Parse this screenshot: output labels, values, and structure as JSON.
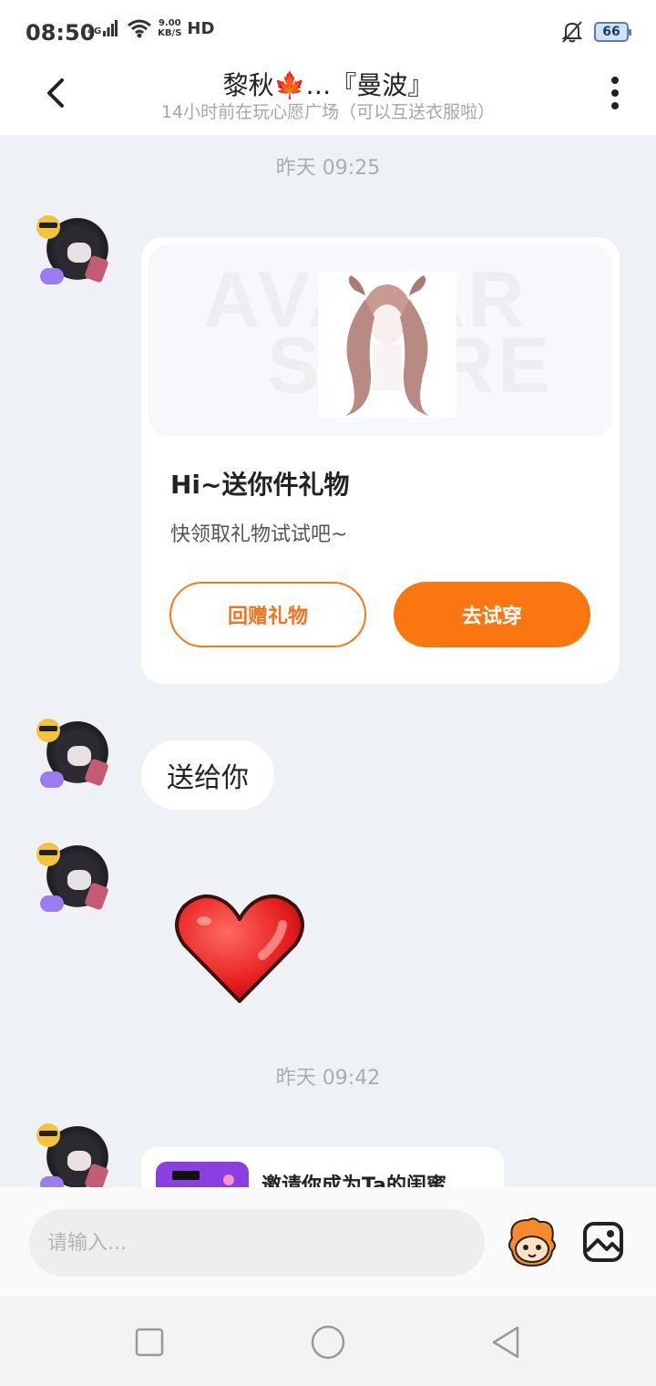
{
  "status_bar": {
    "time": "08:50",
    "network": "4G",
    "speed_value": "9.00",
    "speed_unit": "KB/S",
    "hd": "HD",
    "battery": "66"
  },
  "header": {
    "title": "黎秋🍁…『曼波』",
    "subtitle": "14小时前在玩心愿广场（可以互送衣服啦）"
  },
  "chat": {
    "timestamp_1": "昨天 09:25",
    "gift_card": {
      "watermark_line1": "AVATAR",
      "watermark_line2": "STORE",
      "title": "Hi~送你件礼物",
      "description": "快领取礼物试试吧~",
      "return_gift_label": "回赠礼物",
      "try_on_label": "去试穿"
    },
    "text_message": "送给你",
    "timestamp_2": "昨天 09:42",
    "invite_card": {
      "text": "邀请你成为Ta的闺蜜"
    }
  },
  "input_bar": {
    "placeholder": "请输入..."
  },
  "colors": {
    "accent": "#f97611",
    "background": "#eef2f7"
  },
  "icons": {
    "back": "chevron-left-icon",
    "more": "more-vertical-icon",
    "emoji": "emoji-mascot-icon",
    "image": "image-icon",
    "nav_recent": "square-icon",
    "nav_home": "circle-icon",
    "nav_back": "triangle-back-icon"
  }
}
